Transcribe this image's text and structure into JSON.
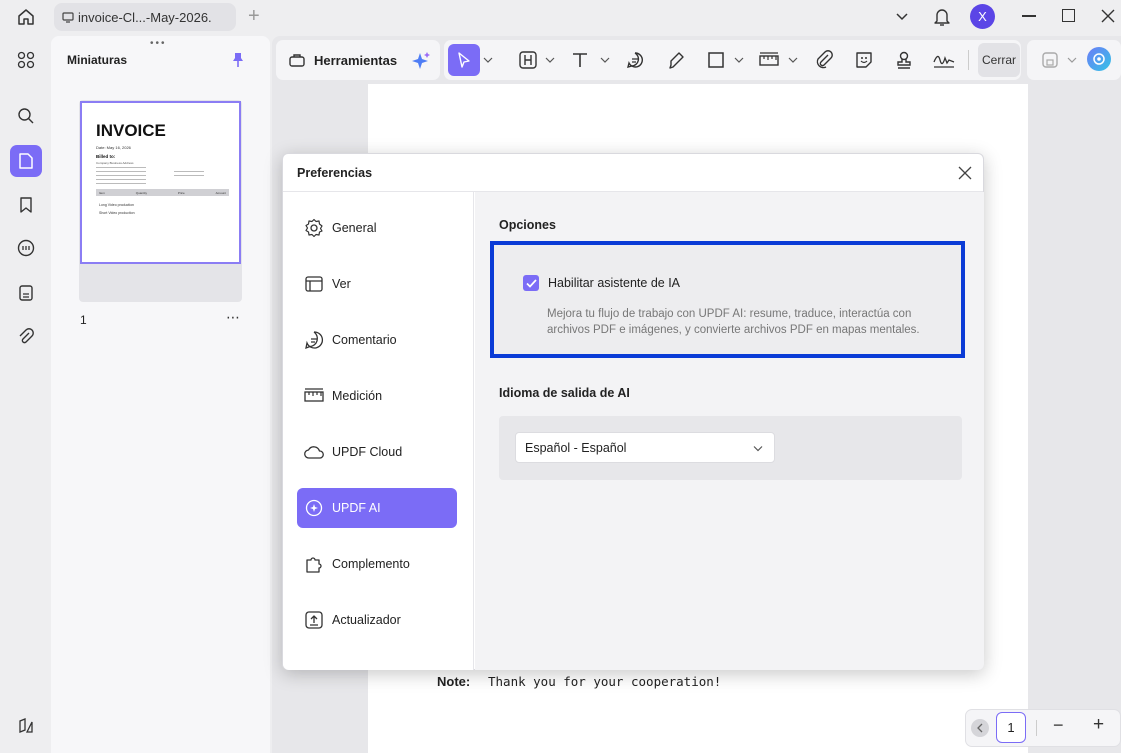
{
  "titlebar": {
    "tab_title": "invoice-Cl...-May-2026.",
    "new_tab": "+",
    "avatar_letter": "X"
  },
  "sidebar": {
    "title": "Miniaturas",
    "page_number": "1",
    "more": "⋯"
  },
  "thumbnail": {
    "heading": "INVOICE",
    "date": "Date:   May 16, 2026",
    "billed_to": "Billed to:",
    "company_line": "Company Business Address",
    "row1": "Long Video production",
    "row2": "Short Video production",
    "cols": [
      "Item",
      "Quantity",
      "Price",
      "Amount"
    ]
  },
  "toolbar": {
    "tools_label": "Herramientas",
    "close_label": "Cerrar"
  },
  "document": {
    "note_label": "Note:",
    "note_text": "Thank you for your cooperation!"
  },
  "dialog": {
    "title": "Preferencias",
    "nav": [
      {
        "label": "General",
        "icon": "gear-icon"
      },
      {
        "label": "Ver",
        "icon": "view-icon"
      },
      {
        "label": "Comentario",
        "icon": "comment-icon"
      },
      {
        "label": "Medición",
        "icon": "ruler-icon"
      },
      {
        "label": "UPDF Cloud",
        "icon": "cloud-icon"
      },
      {
        "label": "UPDF AI",
        "icon": "ai-icon"
      },
      {
        "label": "Complemento",
        "icon": "plugin-icon"
      },
      {
        "label": "Actualizador",
        "icon": "updater-icon"
      }
    ],
    "active_nav": "UPDF AI",
    "options_title": "Opciones",
    "enable_ai_label": "Habilitar asistente de IA",
    "enable_ai_checked": true,
    "enable_ai_description_1": "Mejora tu flujo de trabajo con UPDF AI: resume, traduce, interactúa con",
    "enable_ai_description_2": "archivos PDF e imágenes, y convierte archivos PDF en mapas mentales.",
    "output_language_title": "Idioma de salida de AI",
    "output_language_value": "Español - Español"
  },
  "pager": {
    "current_page": "1",
    "zoom_out": "−",
    "zoom_in": "+"
  },
  "colors": {
    "accent": "#7b6cf6",
    "highlight_border": "#0a3bd6"
  }
}
